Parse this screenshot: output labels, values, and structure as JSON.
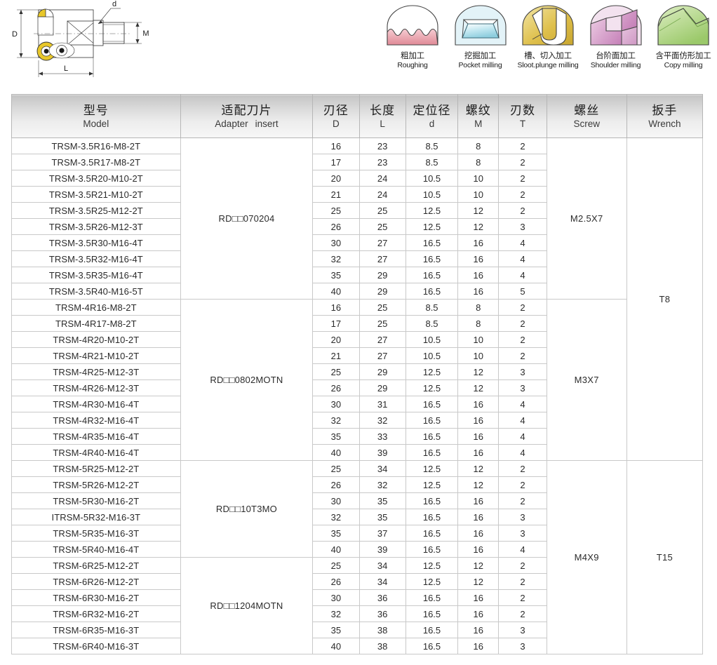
{
  "diagram": {
    "name": "round-insert-milling-cutter-drawing",
    "labels": {
      "d": "d",
      "D": "D",
      "M": "M",
      "L": "L"
    }
  },
  "applications": [
    {
      "icon": "roughing-icon",
      "cn": "粗加工",
      "en": "Roughing",
      "color": "#e8a0a8"
    },
    {
      "icon": "pocket-milling-icon",
      "cn": "挖掘加工",
      "en": "Pocket milling",
      "color": "#a6dce8"
    },
    {
      "icon": "slot-plunge-icon",
      "cn": "槽、切入加工",
      "en": "Sloot.plunge milling",
      "color": "#e0c24a"
    },
    {
      "icon": "shoulder-milling-icon",
      "cn": "台阶面加工",
      "en": "Shoulder milling",
      "color": "#d79ccb"
    },
    {
      "icon": "copy-milling-icon",
      "cn": "含平面仿形加工",
      "en": "Copy milling",
      "color": "#b7d98a"
    }
  ],
  "table": {
    "headers": [
      {
        "cn": "型号",
        "en": "Model",
        "en2": ""
      },
      {
        "cn": "适配刀片",
        "en": "Adapter",
        "en2": "insert"
      },
      {
        "cn": "刃径",
        "en": "D",
        "en2": ""
      },
      {
        "cn": "长度",
        "en": "L",
        "en2": ""
      },
      {
        "cn": "定位径",
        "en": "d",
        "en2": ""
      },
      {
        "cn": "螺纹",
        "en": "M",
        "en2": ""
      },
      {
        "cn": "刃数",
        "en": "T",
        "en2": ""
      },
      {
        "cn": "螺丝",
        "en": "Screw",
        "en2": ""
      },
      {
        "cn": "扳手",
        "en": "Wrench",
        "en2": ""
      }
    ],
    "groups": [
      {
        "insert": "RD□□070204",
        "screw": "M2.5X7",
        "rows": [
          {
            "model": "TRSM-3.5R16-M8-2T",
            "D": "16",
            "L": "23",
            "d": "8.5",
            "M": "8",
            "T": "2"
          },
          {
            "model": "TRSM-3.5R17-M8-2T",
            "D": "17",
            "L": "23",
            "d": "8.5",
            "M": "8",
            "T": "2"
          },
          {
            "model": "TRSM-3.5R20-M10-2T",
            "D": "20",
            "L": "24",
            "d": "10.5",
            "M": "10",
            "T": "2"
          },
          {
            "model": "TRSM-3.5R21-M10-2T",
            "D": "21",
            "L": "24",
            "d": "10.5",
            "M": "10",
            "T": "2"
          },
          {
            "model": "TRSM-3.5R25-M12-2T",
            "D": "25",
            "L": "25",
            "d": "12.5",
            "M": "12",
            "T": "2"
          },
          {
            "model": "TRSM-3.5R26-M12-3T",
            "D": "26",
            "L": "25",
            "d": "12.5",
            "M": "12",
            "T": "3"
          },
          {
            "model": "TRSM-3.5R30-M16-4T",
            "D": "30",
            "L": "27",
            "d": "16.5",
            "M": "16",
            "T": "4"
          },
          {
            "model": "TRSM-3.5R32-M16-4T",
            "D": "32",
            "L": "27",
            "d": "16.5",
            "M": "16",
            "T": "4"
          },
          {
            "model": "TRSM-3.5R35-M16-4T",
            "D": "35",
            "L": "29",
            "d": "16.5",
            "M": "16",
            "T": "4"
          },
          {
            "model": "TRSM-3.5R40-M16-5T",
            "D": "40",
            "L": "29",
            "d": "16.5",
            "M": "16",
            "T": "5"
          }
        ]
      },
      {
        "insert": "RD□□0802MOTN",
        "screw": "M3X7",
        "rows": [
          {
            "model": "TRSM-4R16-M8-2T",
            "D": "16",
            "L": "25",
            "d": "8.5",
            "M": "8",
            "T": "2"
          },
          {
            "model": "TRSM-4R17-M8-2T",
            "D": "17",
            "L": "25",
            "d": "8.5",
            "M": "8",
            "T": "2"
          },
          {
            "model": "TRSM-4R20-M10-2T",
            "D": "20",
            "L": "27",
            "d": "10.5",
            "M": "10",
            "T": "2"
          },
          {
            "model": "TRSM-4R21-M10-2T",
            "D": "21",
            "L": "27",
            "d": "10.5",
            "M": "10",
            "T": "2"
          },
          {
            "model": "TRSM-4R25-M12-3T",
            "D": "25",
            "L": "29",
            "d": "12.5",
            "M": "12",
            "T": "3"
          },
          {
            "model": "TRSM-4R26-M12-3T",
            "D": "26",
            "L": "29",
            "d": "12.5",
            "M": "12",
            "T": "3"
          },
          {
            "model": "TRSM-4R30-M16-4T",
            "D": "30",
            "L": "31",
            "d": "16.5",
            "M": "16",
            "T": "4"
          },
          {
            "model": "TRSM-4R32-M16-4T",
            "D": "32",
            "L": "32",
            "d": "16.5",
            "M": "16",
            "T": "4"
          },
          {
            "model": "TRSM-4R35-M16-4T",
            "D": "35",
            "L": "33",
            "d": "16.5",
            "M": "16",
            "T": "4"
          },
          {
            "model": "TRSM-4R40-M16-4T",
            "D": "40",
            "L": "39",
            "d": "16.5",
            "M": "16",
            "T": "4"
          }
        ]
      },
      {
        "insert": "RD□□10T3MO",
        "screw": "M4X9",
        "rows": [
          {
            "model": "TRSM-5R25-M12-2T",
            "D": "25",
            "L": "34",
            "d": "12.5",
            "M": "12",
            "T": "2"
          },
          {
            "model": "TRSM-5R26-M12-2T",
            "D": "26",
            "L": "32",
            "d": "12.5",
            "M": "12",
            "T": "2"
          },
          {
            "model": "TRSM-5R30-M16-2T",
            "D": "30",
            "L": "35",
            "d": "16.5",
            "M": "16",
            "T": "2"
          },
          {
            "model": "ITRSM-5R32-M16-3T",
            "D": "32",
            "L": "35",
            "d": "16.5",
            "M": "16",
            "T": "3"
          },
          {
            "model": "TRSM-5R35-M16-3T",
            "D": "35",
            "L": "37",
            "d": "16.5",
            "M": "16",
            "T": "3"
          },
          {
            "model": "TRSM-5R40-M16-4T",
            "D": "40",
            "L": "39",
            "d": "16.5",
            "M": "16",
            "T": "4"
          }
        ]
      },
      {
        "insert": "RD□□1204MOTN",
        "screw": "",
        "rows": [
          {
            "model": "TRSM-6R25-M12-2T",
            "D": "25",
            "L": "34",
            "d": "12.5",
            "M": "12",
            "T": "2"
          },
          {
            "model": "TRSM-6R26-M12-2T",
            "D": "26",
            "L": "34",
            "d": "12.5",
            "M": "12",
            "T": "2"
          },
          {
            "model": "TRSM-6R30-M16-2T",
            "D": "30",
            "L": "36",
            "d": "16.5",
            "M": "16",
            "T": "2"
          },
          {
            "model": "TRSM-6R32-M16-2T",
            "D": "32",
            "L": "36",
            "d": "16.5",
            "M": "16",
            "T": "2"
          },
          {
            "model": "TRSM-6R35-M16-3T",
            "D": "35",
            "L": "38",
            "d": "16.5",
            "M": "16",
            "T": "3"
          },
          {
            "model": "TRSM-6R40-M16-3T",
            "D": "40",
            "L": "38",
            "d": "16.5",
            "M": "16",
            "T": "3"
          }
        ]
      }
    ],
    "wrenches": [
      {
        "value": "T8",
        "span_groups": [
          0,
          1
        ]
      },
      {
        "value": "T15",
        "span_groups": [
          2,
          3
        ]
      }
    ]
  }
}
